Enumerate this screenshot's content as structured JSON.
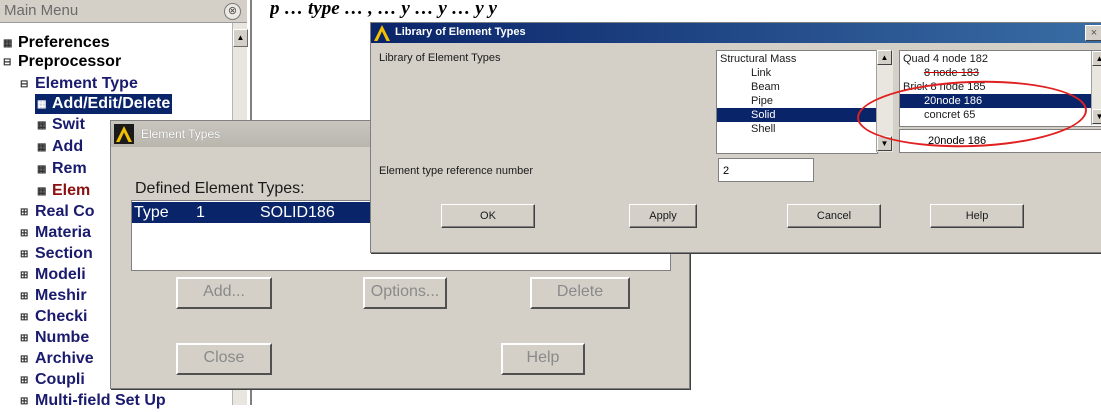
{
  "doc_top_text": "p  …  type …  , …  y …  y …  y    y",
  "main_menu": {
    "title": "Main Menu",
    "collapse_glyph": "⊗",
    "items": [
      {
        "label": "Preferences",
        "icon": "▦"
      },
      {
        "label": "Preprocessor",
        "icon": "⊟"
      },
      {
        "label": "Element Type",
        "icon": "⊟"
      },
      {
        "label": "Add/Edit/Delete",
        "icon": "▦"
      },
      {
        "label": "Swit",
        "icon": "▦"
      },
      {
        "label": "Add",
        "icon": "▦"
      },
      {
        "label": "Rem",
        "icon": "▦"
      },
      {
        "label": "Elem",
        "icon": "▦"
      },
      {
        "label": "Real Co",
        "icon": "⊞"
      },
      {
        "label": "Materia",
        "icon": "⊞"
      },
      {
        "label": "Section",
        "icon": "⊞"
      },
      {
        "label": "Modeli",
        "icon": "⊞"
      },
      {
        "label": "Meshir",
        "icon": "⊞"
      },
      {
        "label": "Checki",
        "icon": "⊞"
      },
      {
        "label": "Numbe",
        "icon": "⊞"
      },
      {
        "label": "Archive",
        "icon": "⊞"
      },
      {
        "label": "Coupli",
        "icon": "⊞"
      },
      {
        "label": "Multi-field Set Up",
        "icon": "⊞"
      }
    ]
  },
  "element_types_dialog": {
    "title": "Element Types",
    "defined_label": "Defined Element Types:",
    "rows": [
      {
        "type": "Type",
        "number": "1",
        "name": "SOLID186"
      }
    ],
    "buttons": {
      "add": "Add...",
      "options": "Options...",
      "delete": "Delete",
      "close": "Close",
      "help": "Help"
    }
  },
  "library_dialog": {
    "title": "Library of Element Types",
    "close_glyph": "×",
    "library_label": "Library of Element Types",
    "categories": [
      "Structural Mass",
      "Link",
      "Beam",
      "Pipe",
      "Solid",
      "Shell"
    ],
    "selected_category": "Solid",
    "elements": [
      "Quad  4 node 182",
      "8 node 183",
      "Brick 8 node 185",
      "20node 186",
      "concret 65"
    ],
    "selected_element": "20node 186",
    "selected_field_value": "20node 186",
    "ref_number_label": "Element type reference number",
    "ref_number_value": "2",
    "buttons": {
      "ok": "OK",
      "apply": "Apply",
      "cancel": "Cancel",
      "help": "Help"
    }
  },
  "colors": {
    "selection": "#0a246a",
    "dialog_bg": "#d4d0c8",
    "menu_text": "#1a1a6e",
    "highlight_ellipse": "#e02020"
  }
}
